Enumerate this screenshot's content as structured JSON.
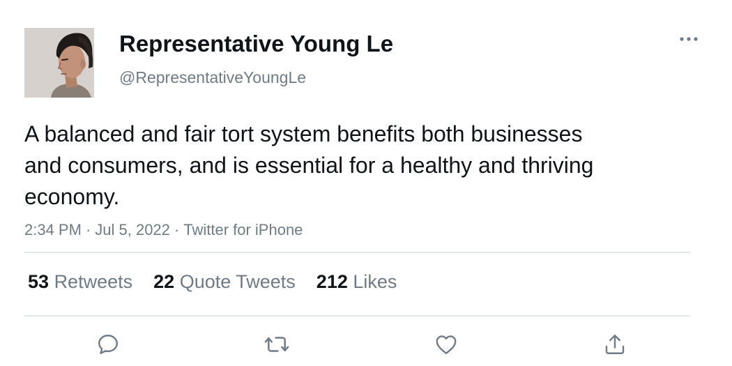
{
  "author": {
    "name": "Representative Young Le",
    "handle": "@RepresentativeYoungLe"
  },
  "tweet": {
    "text": "A balanced and fair tort system benefits both businesses and consumers, and is essential for a healthy and thriving economy.",
    "time": "2:34 PM",
    "date": "Jul 5, 2022",
    "source": "Twitter for iPhone",
    "separator": "·"
  },
  "stats": {
    "retweets": {
      "count": "53",
      "label": "Retweets"
    },
    "quote_tweets": {
      "count": "22",
      "label": "Quote Tweets"
    },
    "likes": {
      "count": "212",
      "label": "Likes"
    }
  },
  "icons": {
    "more": "more-dots-icon",
    "reply": "reply-bubble-icon",
    "retweet": "retweet-arrows-icon",
    "like": "heart-icon",
    "share": "share-upload-icon"
  },
  "colors": {
    "text_primary": "#0f1419",
    "text_secondary": "#6e7b86",
    "divider": "#e2e6e9"
  }
}
